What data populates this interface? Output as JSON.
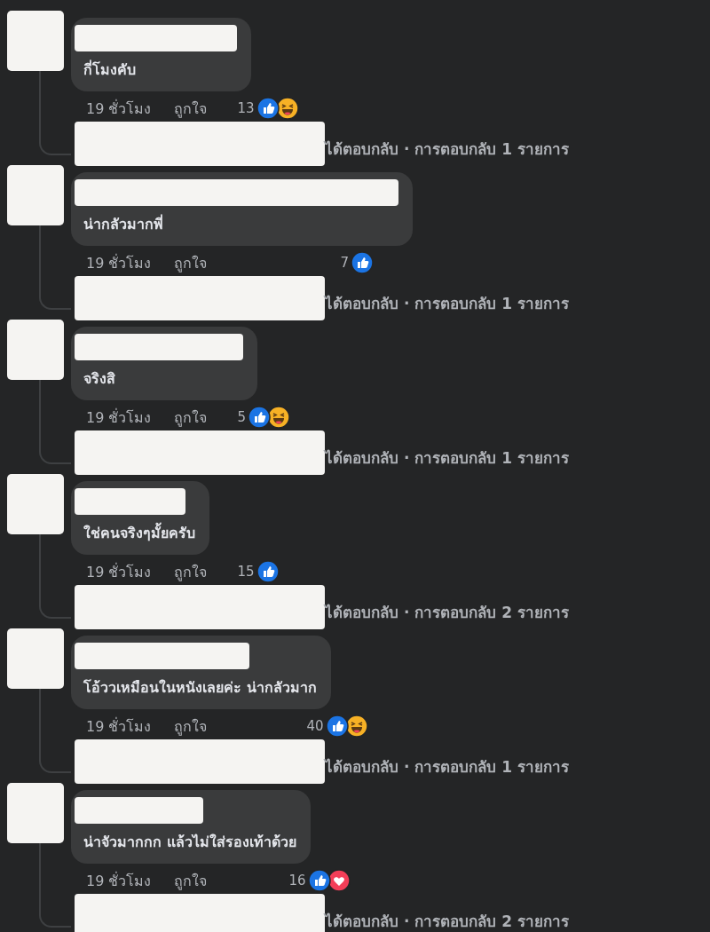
{
  "comments": [
    {
      "text": "กี่โมงคับ",
      "time": "19 ชั่วโมง",
      "like_label": "ถูกใจ",
      "reaction_count": "13",
      "reactions": [
        {
          "kind": "like"
        },
        {
          "kind": "haha"
        }
      ],
      "replies_text": "ได้ตอบกลับ · การตอบกลับ 1 รายการ"
    },
    {
      "text": "น่ากลัวมากพี่",
      "time": "19 ชั่วโมง",
      "like_label": "ถูกใจ",
      "reaction_count": "7",
      "reactions": [
        {
          "kind": "like"
        }
      ],
      "replies_text": "ได้ตอบกลับ · การตอบกลับ 1 รายการ"
    },
    {
      "text": "จริงสิ",
      "time": "19 ชั่วโมง",
      "like_label": "ถูกใจ",
      "reaction_count": "5",
      "reactions": [
        {
          "kind": "like"
        },
        {
          "kind": "haha"
        }
      ],
      "replies_text": "ได้ตอบกลับ · การตอบกลับ 1 รายการ"
    },
    {
      "text": "ใช่คนจริงๆมั้ยครับ",
      "time": "19 ชั่วโมง",
      "like_label": "ถูกใจ",
      "reaction_count": "15",
      "reactions": [
        {
          "kind": "like"
        }
      ],
      "replies_text": "ได้ตอบกลับ · การตอบกลับ 2 รายการ"
    },
    {
      "text": "โอ้ววเหมือนในหนังเลยค่ะ น่ากลัวมาก",
      "time": "19 ชั่วโมง",
      "like_label": "ถูกใจ",
      "reaction_count": "40",
      "reactions": [
        {
          "kind": "like"
        },
        {
          "kind": "haha"
        }
      ],
      "replies_text": "ได้ตอบกลับ · การตอบกลับ 1 รายการ"
    },
    {
      "text": "น่าจัวมากกก แล้วไม่ใส่รองเท้าด้วย",
      "time": "19 ชั่วโมง",
      "like_label": "ถูกใจ",
      "reaction_count": "16",
      "reactions": [
        {
          "kind": "like"
        },
        {
          "kind": "love"
        }
      ],
      "replies_text": "ได้ตอบกลับ · การตอบกลับ 2 รายการ"
    }
  ]
}
